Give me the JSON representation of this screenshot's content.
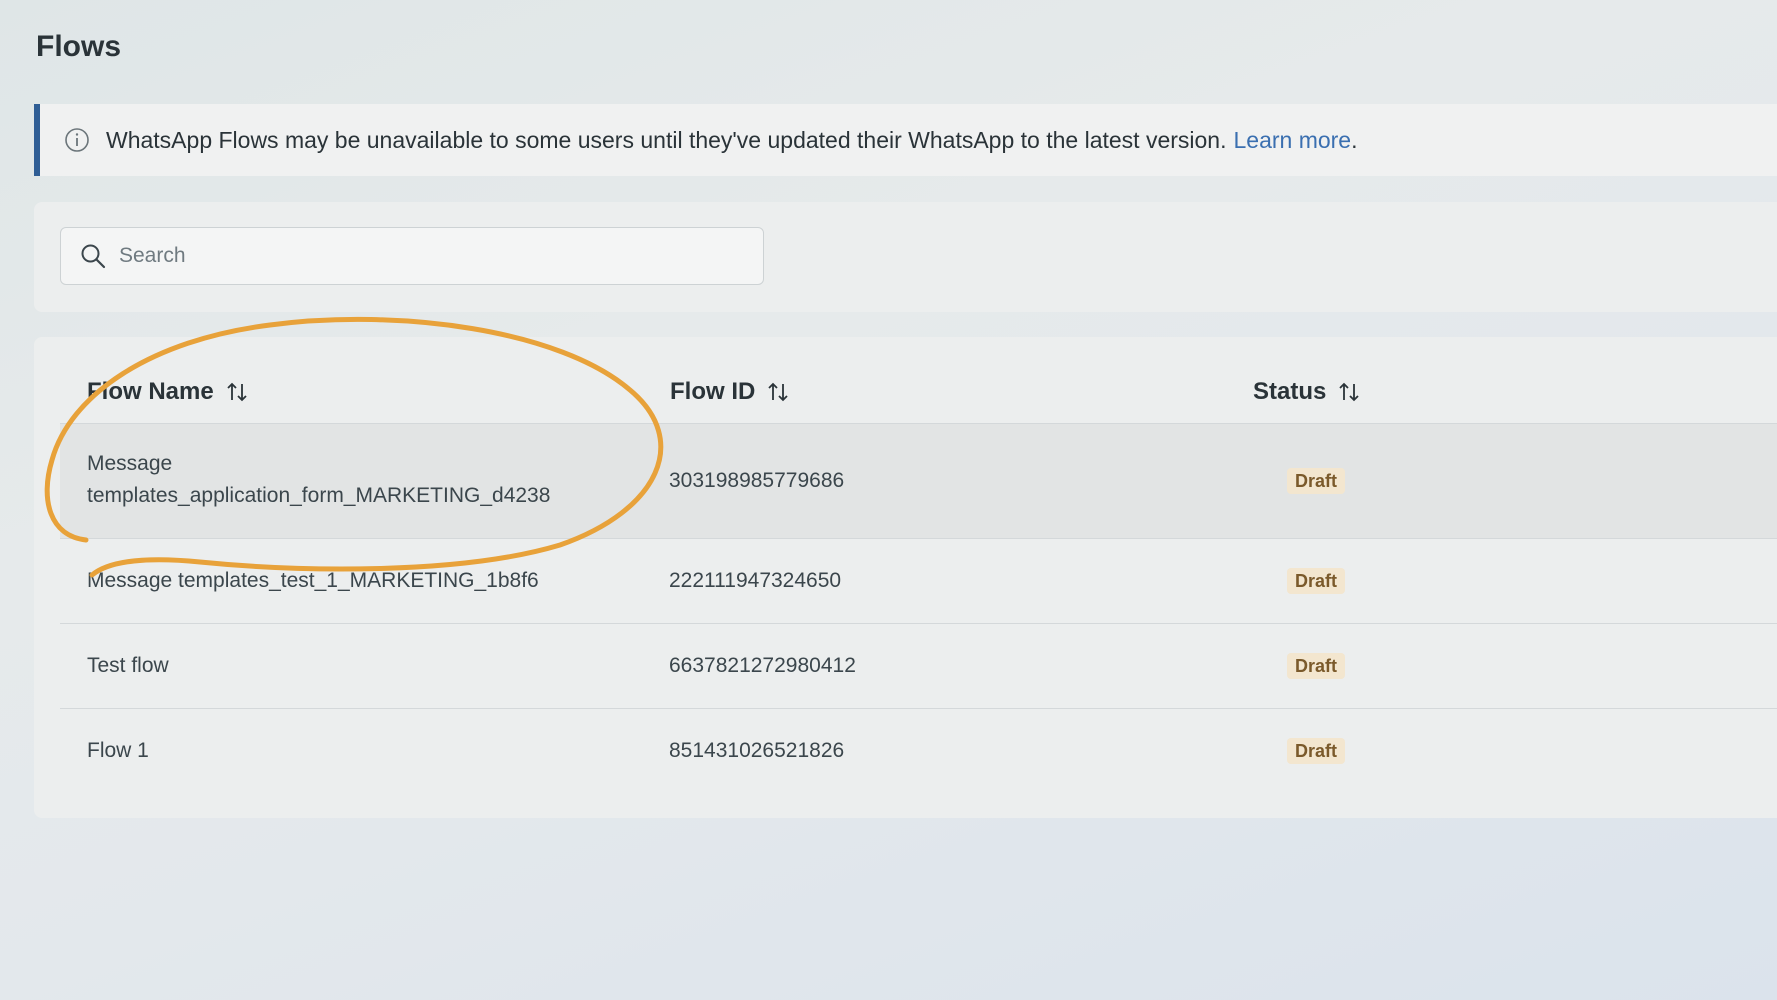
{
  "page": {
    "title": "Flows"
  },
  "banner": {
    "icon": "info-icon",
    "message": "WhatsApp Flows may be unavailable to some users until they've updated their WhatsApp to the latest version.",
    "link_label": "Learn more",
    "link_suffix": ".",
    "accent_color": "#2f5e95"
  },
  "search": {
    "icon": "search-icon",
    "placeholder": "Search",
    "value": ""
  },
  "table": {
    "columns": [
      {
        "label": "Flow Name",
        "sort_icon": "sort-arrows-icon"
      },
      {
        "label": "Flow ID",
        "sort_icon": "sort-arrows-icon"
      },
      {
        "label": "Status",
        "sort_icon": "sort-arrows-icon"
      }
    ],
    "rows": [
      {
        "name_line1": "Message",
        "name_line2": "templates_application_form_MARKETING_d4238",
        "flow_id": "303198985779686",
        "status": "Draft",
        "highlighted": true
      },
      {
        "name": "Message templates_test_1_MARKETING_1b8f6",
        "flow_id": "222111947324650",
        "status": "Draft"
      },
      {
        "name": "Test flow",
        "flow_id": "6637821272980412",
        "status": "Draft"
      },
      {
        "name": "Flow 1",
        "flow_id": "851431026521826",
        "status": "Draft"
      }
    ]
  },
  "annotation": {
    "shape": "hand-drawn ellipse",
    "color": "#e8a23a"
  }
}
